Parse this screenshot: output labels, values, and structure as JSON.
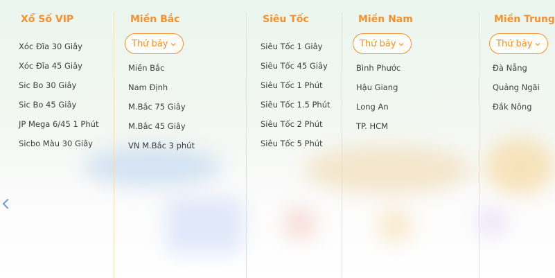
{
  "columns": [
    {
      "title": "Xổ Số VIP",
      "links": [
        "Xóc Đĩa 30 Giây",
        "Xóc Đĩa 45 Giây",
        "Sic Bo 30 Giây",
        "Sic Bo 45 Giây",
        "JP Mega 6/45 1 Phút",
        "Sicbo Màu 30 Giây"
      ]
    },
    {
      "title": "Miền Bắc",
      "day_select": "Thứ bảy",
      "links": [
        "Miền Bắc",
        "Nam Định",
        "M.Bắc 75 Giây",
        "M.Bắc 45 Giây",
        "VN M.Bắc 3 phút"
      ]
    },
    {
      "title": "Siêu Tốc",
      "links": [
        "Siêu Tốc 1 Giây",
        "Siêu Tốc 45 Giây",
        "Siêu Tốc 1 Phút",
        "Siêu Tốc 1.5 Phút",
        "Siêu Tốc 2 Phút",
        "Siêu Tốc 5 Phút"
      ]
    },
    {
      "title": "Miền Nam",
      "day_select": "Thứ bảy",
      "links": [
        "Bình Phước",
        "Hậu Giang",
        "Long An",
        "TP. HCM"
      ]
    },
    {
      "title": "Miền Trung",
      "day_select": "Thứ bảy",
      "links": [
        "Đà Nẵng",
        "Quảng Ngãi",
        "Đắk Nông"
      ]
    }
  ],
  "colors": {
    "accent": "#f7902d",
    "text": "#3d3d3d",
    "divider": "#f3dfb5",
    "arrow": "#6f9bd6"
  },
  "icons": {
    "chevron": "chevron-down-icon",
    "carousel_prev": "chevron-left-icon"
  }
}
